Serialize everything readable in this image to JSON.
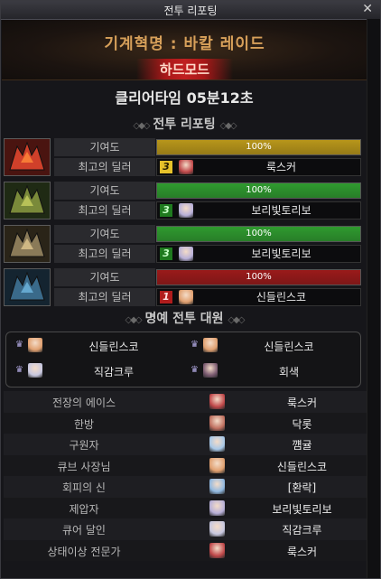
{
  "window": {
    "title": "전투 리포팅",
    "close_glyph": "✕"
  },
  "banner": {
    "raid_name": "기계혁명 : 바칼 레이드",
    "mode": "하드모드"
  },
  "clear_time": "클리어타임  05분12초",
  "report": {
    "title": "전투 리포팅",
    "contribution_label": "기여도",
    "top_dealer_label": "최고의 딜러",
    "parties": [
      {
        "portrait": "red-dragon-portrait",
        "bar_color": "#b8961a",
        "progress_text": "100%",
        "progress": 1.0,
        "rank": "3",
        "rank_bg": "#e6c12a",
        "rank_fg": "#2a2000",
        "avatar_color": "#c0484a",
        "dealer": "룩스커"
      },
      {
        "portrait": "green-dragon-portrait",
        "bar_color": "#2f9a2f",
        "progress_text": "100%",
        "progress": 1.0,
        "rank": "3",
        "rank_bg": "#1f7a1f",
        "rank_fg": "#c8ffc8",
        "avatar_color": "#b8b0d8",
        "dealer": "보리빛토리보"
      },
      {
        "portrait": "gold-dragon-portrait",
        "bar_color": "#2f9a2f",
        "progress_text": "100%",
        "progress": 1.0,
        "rank": "3",
        "rank_bg": "#1f7a1f",
        "rank_fg": "#c8ffc8",
        "avatar_color": "#b8b0d8",
        "dealer": "보리빛토리보"
      },
      {
        "portrait": "blue-dragon-portrait",
        "bar_color": "#9a1a1a",
        "progress_text": "100%",
        "progress": 1.0,
        "rank": "1",
        "rank_bg": "#b01c1c",
        "rank_fg": "#ffe0e0",
        "avatar_color": "#e0a070",
        "dealer": "신들린스코"
      }
    ]
  },
  "honor": {
    "title": "명예 전투 대원",
    "members": [
      {
        "avatar_color": "#e0a070",
        "name": "신들린스코"
      },
      {
        "avatar_color": "#e0a070",
        "name": "신들린스코"
      },
      {
        "avatar_color": "#c8c8e0",
        "name": "직감크루"
      },
      {
        "avatar_color": "#7a5a70",
        "name": "회색"
      }
    ]
  },
  "awards": [
    {
      "title": "전장의 에이스",
      "avatar_color": "#c0484a",
      "player": "룩스커"
    },
    {
      "title": "한방",
      "avatar_color": "#c07060",
      "player": "닥롯"
    },
    {
      "title": "구원자",
      "avatar_color": "#a8c8e8",
      "player": "꺰귤"
    },
    {
      "title": "큐브 사장님",
      "avatar_color": "#e0a070",
      "player": "신들린스코"
    },
    {
      "title": "회피의 신",
      "avatar_color": "#90b8e0",
      "player": "[환락]"
    },
    {
      "title": "제압자",
      "avatar_color": "#b8b0d8",
      "player": "보리빛토리보"
    },
    {
      "title": "큐어 달인",
      "avatar_color": "#c8c8e0",
      "player": "직감크루"
    },
    {
      "title": "상태이상 전문가",
      "avatar_color": "#c0484a",
      "player": "룩스커"
    }
  ]
}
